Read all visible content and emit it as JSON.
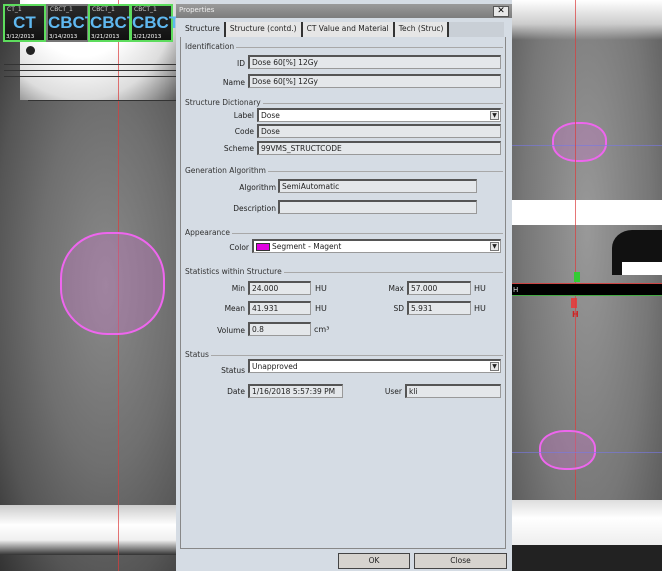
{
  "thumbnails": [
    {
      "series": "CT_1",
      "modality": "CT",
      "date": "3/12/2013"
    },
    {
      "series": "CBCT_1",
      "modality": "CBCT",
      "date": "3/14/2013"
    },
    {
      "series": "CBCT_1",
      "modality": "CBCT",
      "date": "3/21/2013"
    },
    {
      "series": "CBCT_1",
      "modality": "CBCT",
      "date": "3/21/2013"
    }
  ],
  "dialog": {
    "title": "Properties",
    "close": "✕",
    "tabs": [
      "Structure",
      "Structure (contd.)",
      "CT Value and Material",
      "Tech (Struc)"
    ],
    "identification": {
      "header": "Identification",
      "id_label": "ID",
      "id": "Dose 60[%] 12Gy",
      "name_label": "Name",
      "name": "Dose 60[%] 12Gy"
    },
    "dictionary": {
      "header": "Structure Dictionary",
      "label_label": "Label",
      "label": "Dose",
      "code_label": "Code",
      "code": "Dose",
      "scheme_label": "Scheme",
      "scheme": "99VMS_STRUCTCODE"
    },
    "generation": {
      "header": "Generation Algorithm",
      "algorithm_label": "Algorithm",
      "algorithm": "SemiAutomatic",
      "description_label": "Description",
      "description": ""
    },
    "appearance": {
      "header": "Appearance",
      "color_label": "Color",
      "color": "Segment - Magent",
      "swatch": "#e000e0"
    },
    "statistics": {
      "header": "Statistics within Structure",
      "min_label": "Min",
      "min": "24.000",
      "max_label": "Max",
      "max": "57.000",
      "mean_label": "Mean",
      "mean": "41.931",
      "sd_label": "SD",
      "sd": "5.931",
      "volume_label": "Volume",
      "volume": "0.8",
      "hu": "HU",
      "cm3": "cm³"
    },
    "status": {
      "header": "Status",
      "status_label": "Status",
      "status": "Unapproved",
      "date_label": "Date",
      "date": "1/16/2018 5:57:39 PM",
      "user_label": "User",
      "user": "kli"
    },
    "ok": "OK",
    "close_btn": "Close"
  },
  "right_view": {
    "marker": "H"
  }
}
